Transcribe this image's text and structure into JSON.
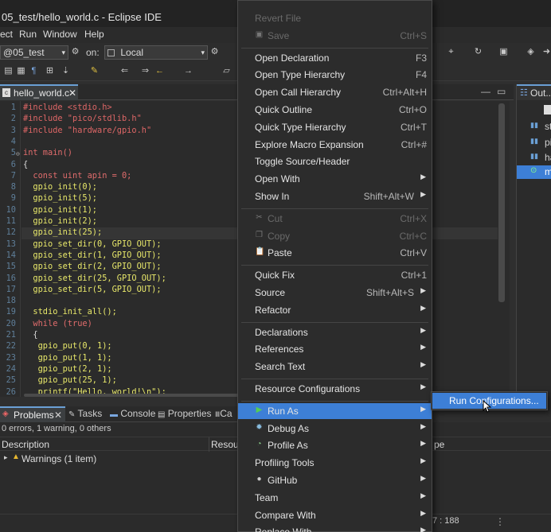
{
  "window": {
    "title": "05_test/hello_world.c - Eclipse IDE"
  },
  "menubar": [
    "ect",
    "Run",
    "Window",
    "Help"
  ],
  "toolbar": {
    "launch_config": "@05_test",
    "on_label": "on:",
    "target": "Local"
  },
  "editor": {
    "tab_label": "hello_world.c",
    "lines": [
      {
        "n": "1",
        "t": "#include <stdio.h>"
      },
      {
        "n": "2",
        "t": "#include \"pico/stdlib.h\""
      },
      {
        "n": "3",
        "t": "#include \"hardware/gpio.h\""
      },
      {
        "n": "4",
        "t": ""
      },
      {
        "n": "5",
        "t": "int main()"
      },
      {
        "n": "6",
        "t": "{"
      },
      {
        "n": "7",
        "t": "  const uint apin = 0;"
      },
      {
        "n": "8",
        "t": "  gpio_init(0);"
      },
      {
        "n": "9",
        "t": "  gpio_init(5);"
      },
      {
        "n": "10",
        "t": "  gpio_init(1);"
      },
      {
        "n": "11",
        "t": "  gpio_init(2);"
      },
      {
        "n": "12",
        "t": "  gpio_init(25);"
      },
      {
        "n": "13",
        "t": "  gpio_set_dir(0, GPIO_OUT);"
      },
      {
        "n": "14",
        "t": "  gpio_set_dir(1, GPIO_OUT);"
      },
      {
        "n": "15",
        "t": "  gpio_set_dir(2, GPIO_OUT);"
      },
      {
        "n": "16",
        "t": "  gpio_set_dir(25, GPIO_OUT);"
      },
      {
        "n": "17",
        "t": "  gpio_set_dir(5, GPIO_OUT);"
      },
      {
        "n": "18",
        "t": ""
      },
      {
        "n": "19",
        "t": "  stdio_init_all();"
      },
      {
        "n": "20",
        "t": "  while (true)"
      },
      {
        "n": "21",
        "t": "  {"
      },
      {
        "n": "22",
        "t": "   gpio_put(0, 1);"
      },
      {
        "n": "23",
        "t": "   gpio_put(1, 1);"
      },
      {
        "n": "24",
        "t": "   gpio_put(2, 1);"
      },
      {
        "n": "25",
        "t": "   gpio_put(25, 1);"
      },
      {
        "n": "26",
        "t": "   printf(\"Hello, world!\\n\");"
      }
    ]
  },
  "outline": {
    "tab_label": "Out",
    "items": [
      "st",
      "pi",
      "ha",
      "m"
    ]
  },
  "bottom_panel": {
    "tabs": [
      "Problems",
      "Tasks",
      "Console",
      "Properties",
      "Ca"
    ],
    "summary": "0 errors, 1 warning, 0 others",
    "col_description": "Description",
    "col_resource": "Resou",
    "col_type": "pe",
    "row": "Warnings (1 item)"
  },
  "statusbar": {
    "position": "7 : 188"
  },
  "context_menu": [
    {
      "label": "Revert File",
      "disabled": true
    },
    {
      "label": "Save",
      "shortcut": "Ctrl+S",
      "disabled": true,
      "icon": "save-icon"
    },
    {
      "sep": true
    },
    {
      "label": "Open Declaration",
      "shortcut": "F3"
    },
    {
      "label": "Open Type Hierarchy",
      "shortcut": "F4"
    },
    {
      "label": "Open Call Hierarchy",
      "shortcut": "Ctrl+Alt+H"
    },
    {
      "label": "Quick Outline",
      "shortcut": "Ctrl+O"
    },
    {
      "label": "Quick Type Hierarchy",
      "shortcut": "Ctrl+T"
    },
    {
      "label": "Explore Macro Expansion",
      "shortcut": "Ctrl+#"
    },
    {
      "label": "Toggle Source/Header"
    },
    {
      "label": "Open With",
      "submenu": true
    },
    {
      "label": "Show In",
      "shortcut": "Shift+Alt+W",
      "submenu": true
    },
    {
      "sep": true
    },
    {
      "label": "Cut",
      "shortcut": "Ctrl+X",
      "disabled": true,
      "icon": "cut-icon"
    },
    {
      "label": "Copy",
      "shortcut": "Ctrl+C",
      "disabled": true,
      "icon": "copy-icon"
    },
    {
      "label": "Paste",
      "shortcut": "Ctrl+V",
      "icon": "paste-icon"
    },
    {
      "sep": true
    },
    {
      "label": "Quick Fix",
      "shortcut": "Ctrl+1"
    },
    {
      "label": "Source",
      "shortcut": "Shift+Alt+S",
      "submenu": true
    },
    {
      "label": "Refactor",
      "submenu": true
    },
    {
      "sep": true
    },
    {
      "label": "Declarations",
      "submenu": true
    },
    {
      "label": "References",
      "submenu": true
    },
    {
      "label": "Search Text",
      "submenu": true
    },
    {
      "sep": true
    },
    {
      "label": "Resource Configurations",
      "submenu": true
    },
    {
      "sep": true
    },
    {
      "label": "Run As",
      "submenu": true,
      "highlight": true,
      "icon": "run-icon"
    },
    {
      "label": "Debug As",
      "submenu": true,
      "icon": "debug-icon"
    },
    {
      "label": "Profile As",
      "submenu": true,
      "icon": "profile-icon"
    },
    {
      "label": "Profiling Tools",
      "submenu": true
    },
    {
      "label": "GitHub",
      "submenu": true,
      "icon": "github-icon"
    },
    {
      "label": "Team",
      "submenu": true
    },
    {
      "label": "Compare With",
      "submenu": true
    },
    {
      "label": "Replace With",
      "submenu": true
    }
  ],
  "submenu": {
    "label": "Run Configurations..."
  },
  "colors": {
    "accent": "#3d7fd6",
    "background": "#2b2b2b",
    "menu_bg": "#2c2c2c"
  }
}
